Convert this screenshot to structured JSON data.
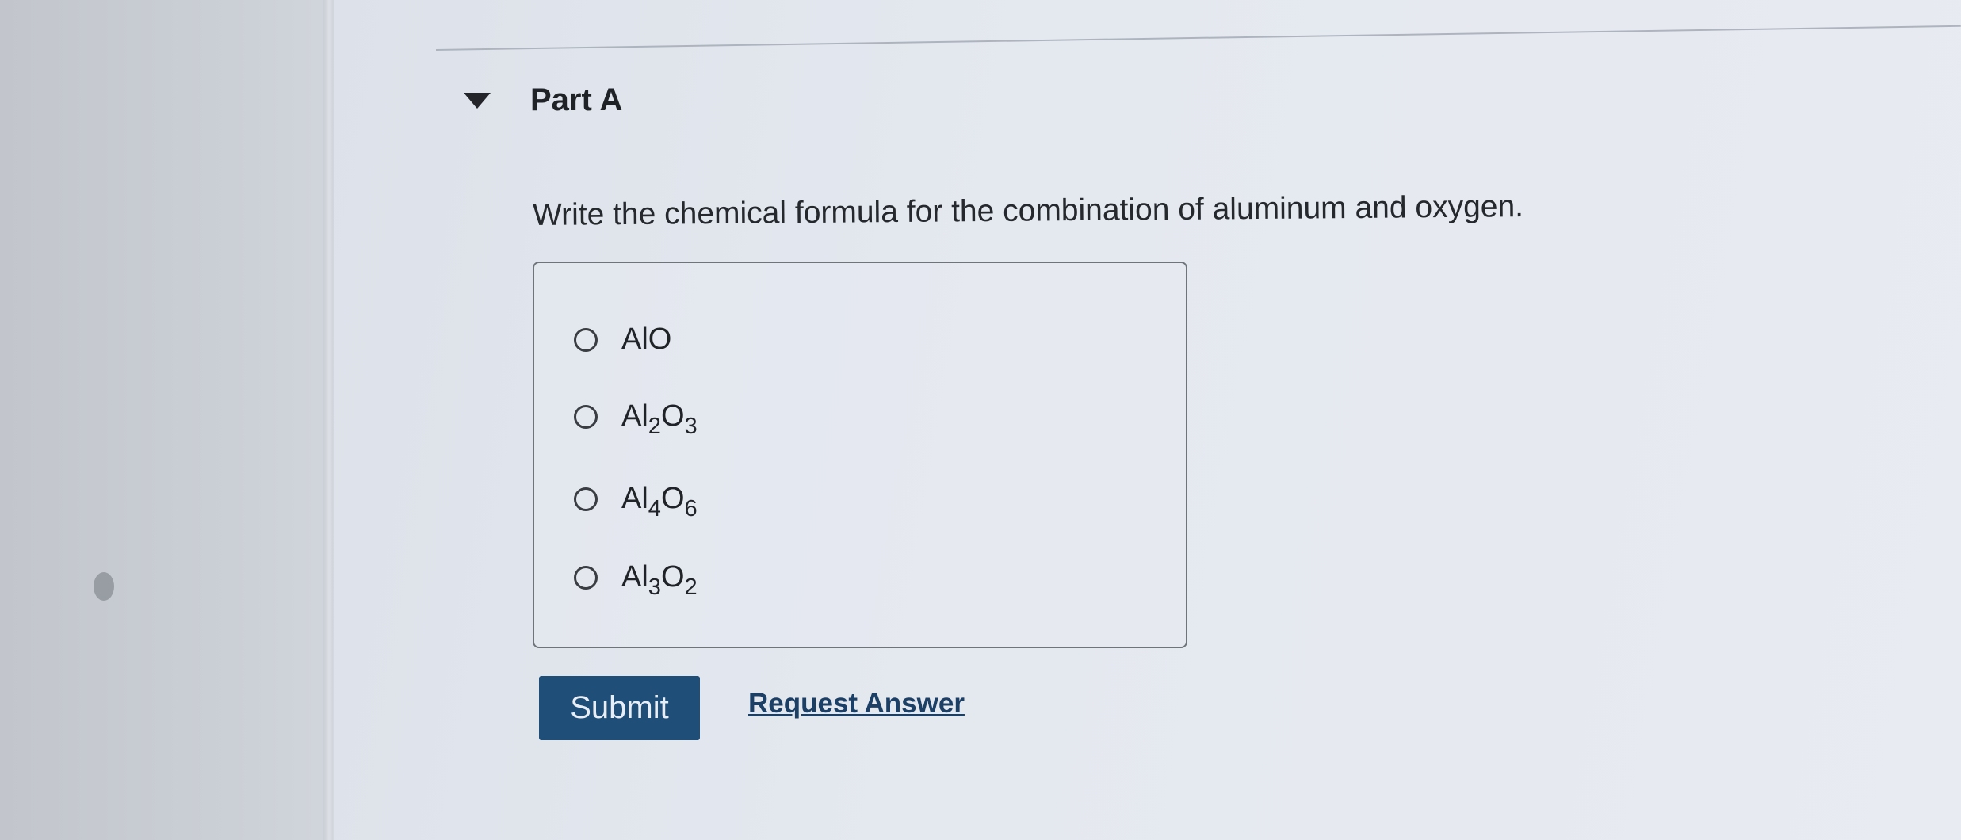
{
  "part": {
    "title": "Part A"
  },
  "question": {
    "text": "Write the chemical formula for the combination of aluminum and oxygen."
  },
  "options": [
    {
      "parts": [
        "AlO"
      ],
      "selected": false
    },
    {
      "parts": [
        "Al",
        "2",
        "O",
        "3"
      ],
      "selected": false
    },
    {
      "parts": [
        "Al",
        "4",
        "O",
        "6"
      ],
      "selected": false
    },
    {
      "parts": [
        "Al",
        "3",
        "O",
        "2"
      ],
      "selected": false
    }
  ],
  "actions": {
    "submit_label": "Submit",
    "request_answer_label": "Request Answer"
  },
  "colors": {
    "submit_bg": "#1f4e79",
    "link": "#1c3f66"
  },
  "icons": {
    "collapse": "caret-down-icon",
    "radio": "radio-empty-icon"
  }
}
